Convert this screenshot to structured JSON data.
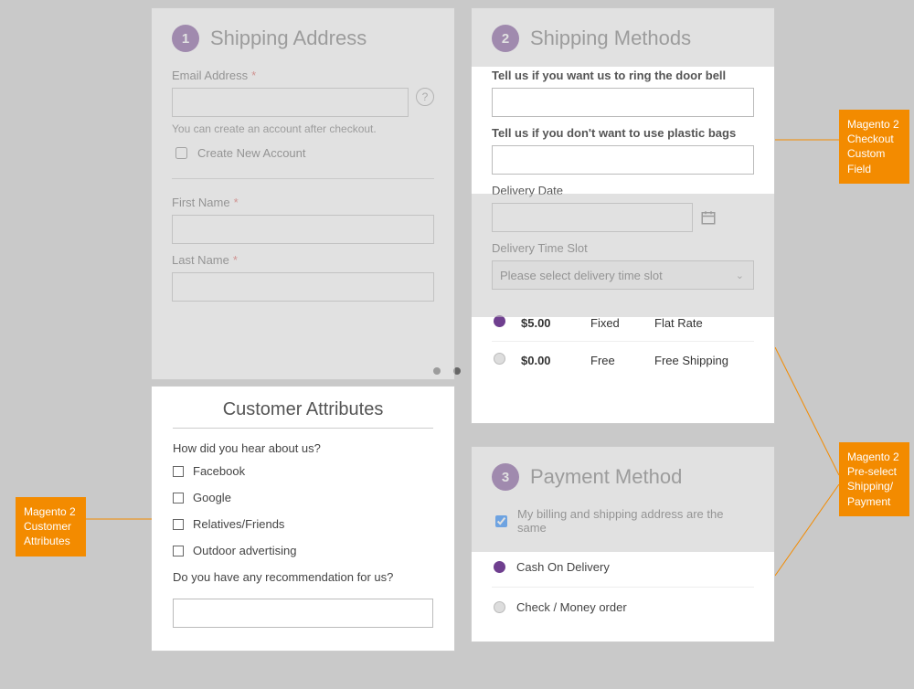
{
  "colors": {
    "accent": "#6f3f8f",
    "callout": "#f38b00"
  },
  "shipping_address": {
    "step": "1",
    "title": "Shipping Address",
    "email_label": "Email Address",
    "hint": "You can create an account after checkout.",
    "create_account_label": "Create New Account",
    "first_name_label": "First Name",
    "last_name_label": "Last Name"
  },
  "customer_attrs": {
    "title": "Customer Attributes",
    "question": "How did you hear about us?",
    "options": [
      "Facebook",
      "Google",
      "Relatives/Friends",
      "Outdoor advertising"
    ],
    "recommend_label": "Do you have any recommendation for us?"
  },
  "shipping_methods": {
    "step": "2",
    "title": "Shipping Methods",
    "custom_field_1": "Tell us if you want us to ring the door bell",
    "custom_field_2": "Tell us if you don't want to use plastic bags",
    "delivery_date_label": "Delivery Date",
    "delivery_slot_label": "Delivery Time Slot",
    "slot_placeholder": "Please select delivery time slot",
    "methods": [
      {
        "price": "$5.00",
        "name": "Fixed",
        "carrier": "Flat Rate",
        "selected": true
      },
      {
        "price": "$0.00",
        "name": "Free",
        "carrier": "Free Shipping",
        "selected": false
      }
    ]
  },
  "payment": {
    "step": "3",
    "title": "Payment Method",
    "billing_same_label": "My billing and shipping address are the same",
    "methods": [
      {
        "label": "Cash On Delivery",
        "selected": true
      },
      {
        "label": "Check / Money order",
        "selected": false
      }
    ]
  },
  "callouts": {
    "customer_attributes": "Magento 2 Customer Attributes",
    "checkout_custom_field": "Magento 2 Checkout Custom Field",
    "preselect": "Magento 2 Pre-select Shipping/ Payment"
  }
}
